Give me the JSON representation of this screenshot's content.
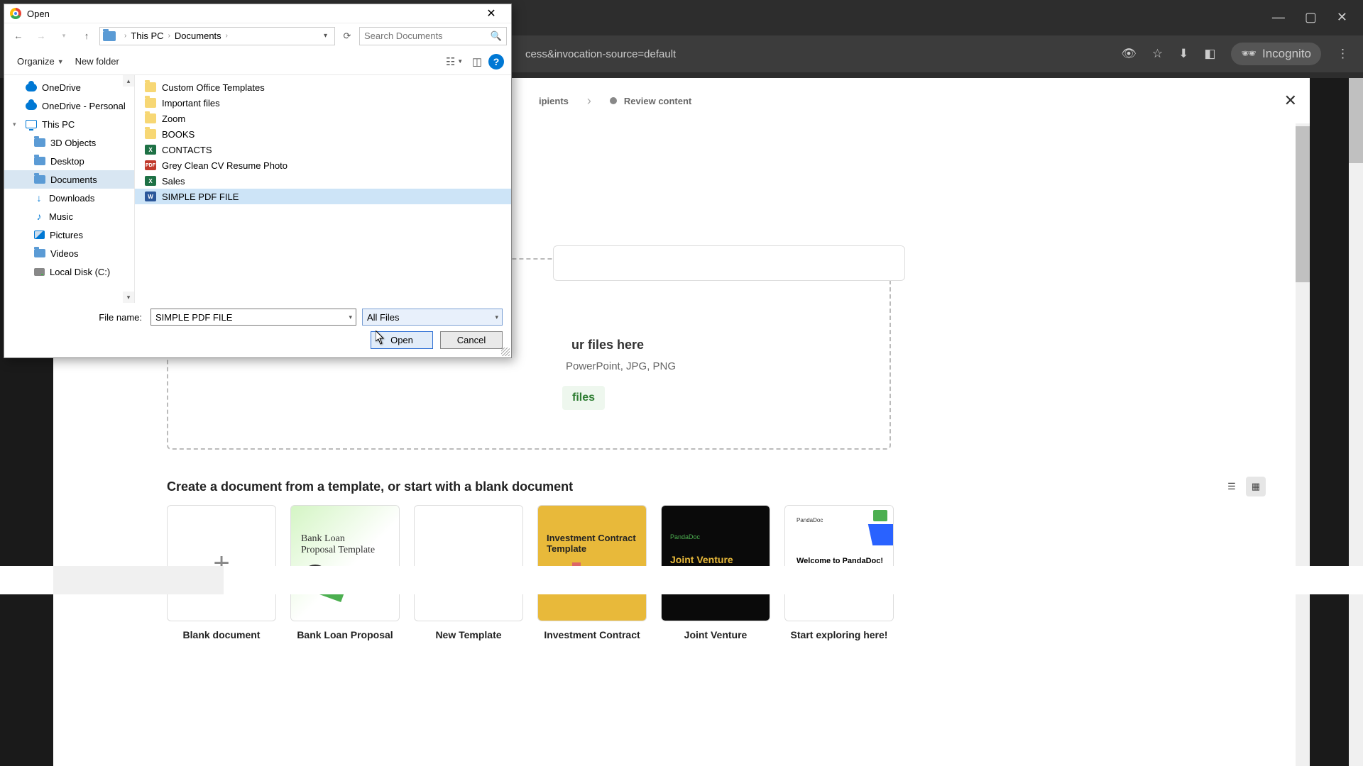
{
  "browser": {
    "url_fragment": "cess&invocation-source=default",
    "incognito": "Incognito"
  },
  "wizard": {
    "step2": "ipients",
    "step3": "Review content"
  },
  "dropzone": {
    "title_frag": "ur files here",
    "sub_frag": "PowerPoint, JPG, PNG",
    "btn_frag": "files"
  },
  "templates_heading": "Create a document from a template, or start with a blank document",
  "templates": [
    {
      "label": "Blank document"
    },
    {
      "label": "Bank Loan Proposal"
    },
    {
      "label": "New Template"
    },
    {
      "label": "Investment Contract"
    },
    {
      "label": "Joint Venture"
    },
    {
      "label": "Start exploring here!"
    }
  ],
  "tmpl_text": {
    "bank1": "Bank Loan",
    "bank2": "Proposal Template",
    "invest": "Investment Contract Template",
    "jv_brand": "PandaDoc",
    "jv": "Joint Venture Agreement Template",
    "expl_brand": "PandaDoc",
    "expl": "Welcome to PandaDoc!"
  },
  "dialog": {
    "title": "Open",
    "breadcrumb": [
      "This PC",
      "Documents"
    ],
    "search_placeholder": "Search Documents",
    "organize": "Organize",
    "new_folder": "New folder",
    "tree": [
      {
        "label": "OneDrive",
        "icon": "cloud"
      },
      {
        "label": "OneDrive - Personal",
        "icon": "cloud"
      },
      {
        "label": "This PC",
        "icon": "pc",
        "expandable": true
      },
      {
        "label": "3D Objects",
        "icon": "folder",
        "l2": true
      },
      {
        "label": "Desktop",
        "icon": "folder",
        "l2": true
      },
      {
        "label": "Documents",
        "icon": "folder",
        "l2": true,
        "sel": true
      },
      {
        "label": "Downloads",
        "icon": "dl",
        "l2": true
      },
      {
        "label": "Music",
        "icon": "music",
        "l2": true
      },
      {
        "label": "Pictures",
        "icon": "pic",
        "l2": true
      },
      {
        "label": "Videos",
        "icon": "folder",
        "l2": true
      },
      {
        "label": "Local Disk (C:)",
        "icon": "disk",
        "l2": true
      }
    ],
    "files": [
      {
        "name": "Custom Office Templates",
        "type": "folder"
      },
      {
        "name": "Important files",
        "type": "folder"
      },
      {
        "name": "Zoom",
        "type": "folder"
      },
      {
        "name": "BOOKS",
        "type": "folder"
      },
      {
        "name": "CONTACTS",
        "type": "xls"
      },
      {
        "name": "Grey Clean CV Resume Photo",
        "type": "pdf"
      },
      {
        "name": "Sales",
        "type": "xls"
      },
      {
        "name": "SIMPLE PDF FILE",
        "type": "doc",
        "sel": true
      }
    ],
    "file_name_label": "File name:",
    "file_name_value": "SIMPLE PDF FILE",
    "file_type": "All Files",
    "open": "Open",
    "cancel": "Cancel"
  }
}
